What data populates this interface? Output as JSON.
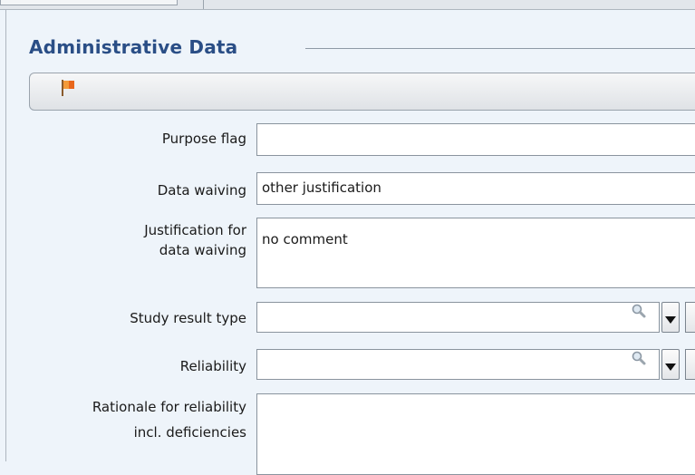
{
  "section": {
    "title": "Administrative Data"
  },
  "toolbar": {
    "flag_icon": "flag-icon"
  },
  "fields": {
    "purpose_flag": {
      "label": "Purpose flag",
      "value": ""
    },
    "data_waiving": {
      "label": "Data waiving",
      "value": "other justification"
    },
    "justification": {
      "label_line1": "Justification for",
      "label_line2": "data waiving",
      "value": "no comment"
    },
    "study_result_type": {
      "label": "Study result type",
      "value": ""
    },
    "reliability": {
      "label": "Reliability",
      "value": ""
    },
    "rationale": {
      "label_line1": "Rationale for reliability",
      "label_line2": "incl. deficiencies",
      "value": ""
    }
  },
  "colors": {
    "title": "#2a4e86",
    "background": "#eef4fa",
    "flag": "#e8661b"
  }
}
